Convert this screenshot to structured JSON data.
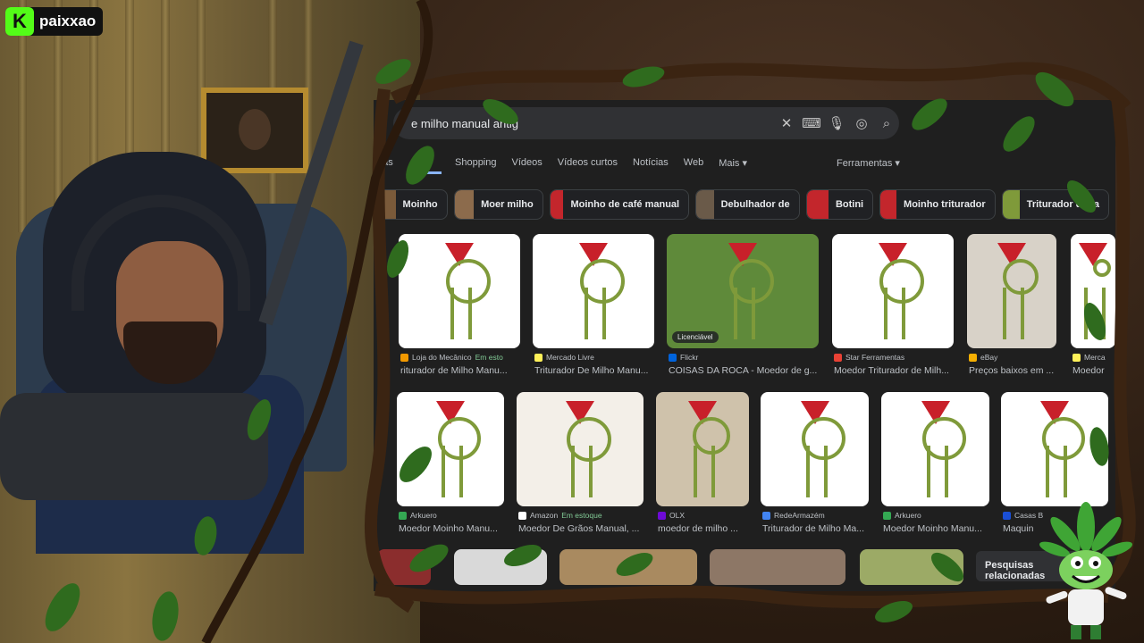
{
  "brand": {
    "logo_letter": "K",
    "name": "paixxao"
  },
  "search": {
    "query": "e milho manual antig"
  },
  "tabs": [
    {
      "label": "das"
    },
    {
      "label": "Shopping"
    },
    {
      "label": "Vídeos"
    },
    {
      "label": "Vídeos curtos"
    },
    {
      "label": "Notícias"
    },
    {
      "label": "Web"
    },
    {
      "label": "Mais ▾"
    }
  ],
  "tools_label": "Ferramentas ▾",
  "chips": [
    {
      "label": "Moinho",
      "color": "#7a5a3a"
    },
    {
      "label": "Moer milho",
      "color": "#8c6b4c"
    },
    {
      "label": "Moinho de café manual",
      "color": "#c3262c"
    },
    {
      "label": "Debulhador de",
      "color": "#6a5a49"
    },
    {
      "label": "Botini",
      "color": "#c3262c"
    },
    {
      "label": "Moinho triturador",
      "color": "#c3262c"
    },
    {
      "label": "Triturador de ra",
      "color": "#7f9a3a"
    }
  ],
  "row1": [
    {
      "source": "Loja do Mecânico",
      "stock": "Em esto",
      "title": "riturador de Milho Manu...",
      "fav": "#f29900"
    },
    {
      "source": "Mercado Livre",
      "stock": "",
      "title": "Triturador De Milho Manu...",
      "fav": "#fff159"
    },
    {
      "source": "Flickr",
      "stock": "",
      "title": "COISAS DA ROCA - Moedor de g...",
      "fav": "#0063dc",
      "badge": "Licenciável"
    },
    {
      "source": "Star Ferramentas",
      "stock": "",
      "title": "Moedor Triturador de Milh...",
      "fav": "#e94235"
    },
    {
      "source": "eBay",
      "stock": "",
      "title": "Preços baixos em ...",
      "fav": "#f5af02"
    },
    {
      "source": "Merca",
      "stock": "",
      "title": "Moedor",
      "fav": "#fff159"
    }
  ],
  "row2": [
    {
      "source": "Arkuero",
      "stock": "",
      "title": "Moedor Moinho Manu...",
      "fav": "#34a853"
    },
    {
      "source": "Amazon",
      "stock": "Em estoque",
      "title": "Moedor De Grãos Manual, ...",
      "fav": "#ffffff"
    },
    {
      "source": "OLX",
      "stock": "",
      "title": "moedor de milho ...",
      "fav": "#6e0ad6"
    },
    {
      "source": "RedeArmazém",
      "stock": "",
      "title": "Triturador de Milho Ma...",
      "fav": "#4285f4"
    },
    {
      "source": "Arkuero",
      "stock": "",
      "title": "Moedor Moinho Manu...",
      "fav": "#34a853"
    },
    {
      "source": "Casas B",
      "stock": "",
      "title": "Maquin",
      "fav": "#1a4fd6"
    }
  ],
  "related_label": "Pesquisas relacionadas"
}
